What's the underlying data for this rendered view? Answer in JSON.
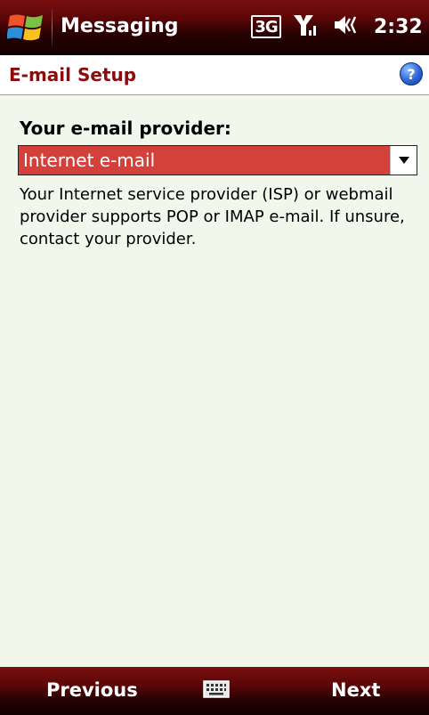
{
  "titlebar": {
    "app_title": "Messaging",
    "network_label": "3G",
    "clock": "2:32"
  },
  "header": {
    "title": "E-mail Setup",
    "help_glyph": "?"
  },
  "form": {
    "provider_label": "Your e-mail provider:",
    "provider_value": "Internet e-mail",
    "description": "Your Internet service provider (ISP) or webmail provider supports POP or IMAP e-mail.  If unsure, contact your provider."
  },
  "softkeys": {
    "left": "Previous",
    "right": "Next"
  },
  "icons": {
    "start": "windows-logo-icon",
    "network": "3g-icon",
    "signal": "signal-strength-icon",
    "volume": "speaker-icon",
    "help": "help-icon",
    "dropdown": "chevron-down-icon",
    "keyboard": "keyboard-icon"
  },
  "colors": {
    "titlebar": "#5a0607",
    "header_text": "#8b0c0c",
    "selection": "#d4413b",
    "background": "#f2f7ec",
    "help": "#2a66d8"
  }
}
